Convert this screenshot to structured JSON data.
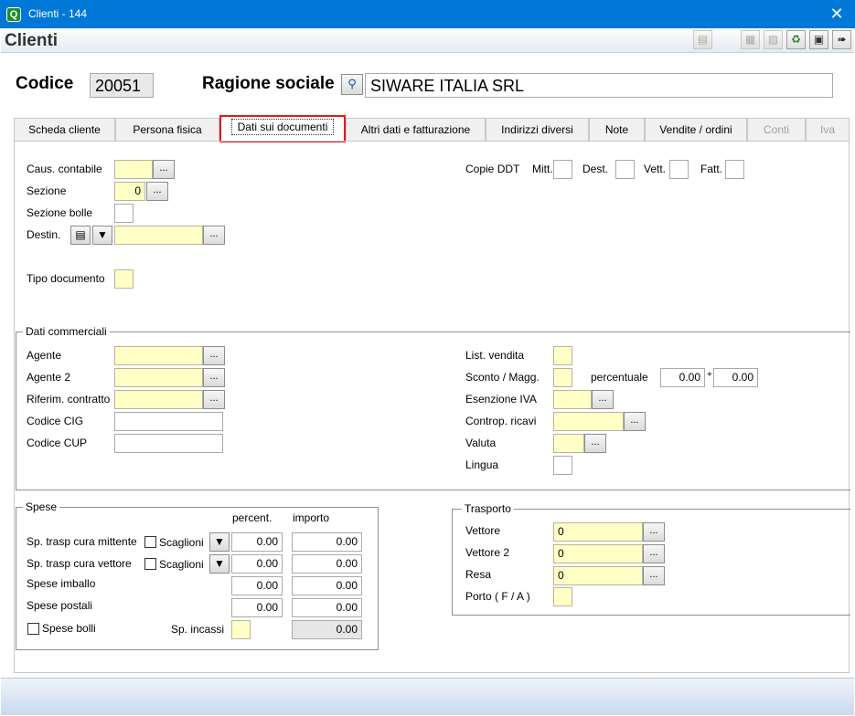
{
  "window": {
    "title": "Clienti - 144",
    "app_icon": "Q",
    "close_glyph": "✕"
  },
  "header": {
    "title": "Clienti"
  },
  "toolbar_icons": [
    "print-icon",
    "copy-icon",
    "paste-icon",
    "recycle-icon",
    "save-icon",
    "exit-icon"
  ],
  "top": {
    "codice_label": "Codice",
    "codice_value": "20051",
    "ragione_label": "Ragione sociale",
    "ragione_value": "SIWARE ITALIA SRL"
  },
  "tabs": [
    {
      "label": "Scheda cliente"
    },
    {
      "label": "Persona fisica"
    },
    {
      "label": "Dati sui documenti"
    },
    {
      "label": "Altri dati e fatturazione"
    },
    {
      "label": "Indirizzi diversi"
    },
    {
      "label": "Note"
    },
    {
      "label": "Vendite / ordini"
    },
    {
      "label": "Conti"
    },
    {
      "label": "Iva"
    }
  ],
  "docs": {
    "caus_label": "Caus. contabile",
    "caus_value": "",
    "sezione_label": "Sezione",
    "sezione_value": "0",
    "sezione_bolle_label": "Sezione bolle",
    "destin_label": "Destin.",
    "tipo_doc_label": "Tipo documento",
    "copie_label": "Copie DDT",
    "mitt_label": "Mitt.",
    "dest_label": "Dest.",
    "vett_label": "Vett.",
    "fatt_label": "Fatt."
  },
  "commerciali": {
    "title": "Dati commerciali",
    "agente_label": "Agente",
    "agente2_label": "Agente 2",
    "riferim_label": "Riferim. contratto",
    "cig_label": "Codice CIG",
    "cup_label": "Codice CUP",
    "listino_label": "List. vendita",
    "sconto_label": "Sconto / Magg.",
    "percentuale_label": "percentuale",
    "perc1": "0.00",
    "plus": "+",
    "perc2": "0.00",
    "esenzione_label": "Esenzione IVA",
    "controp_label": "Controp. ricavi",
    "valuta_label": "Valuta",
    "lingua_label": "Lingua"
  },
  "spese": {
    "title": "Spese",
    "percent_header": "percent.",
    "importo_header": "importo",
    "mittente_label": "Sp. trasp cura mittente",
    "vettore_label": "Sp. trasp cura vettore",
    "scaglioni_label": "Scaglioni",
    "imballo_label": "Spese imballo",
    "postali_label": "Spese postali",
    "bolli_label": "Spese bolli",
    "incassi_label": "Sp. incassi",
    "mittente_perc": "0.00",
    "mittente_imp": "0.00",
    "vettore_perc": "0.00",
    "vettore_imp": "0.00",
    "imballo_perc": "0.00",
    "imballo_imp": "0.00",
    "postali_perc": "0.00",
    "postali_imp": "0.00",
    "incassi_imp": "0.00"
  },
  "trasporto": {
    "title": "Trasporto",
    "vettore_label": "Vettore",
    "vettore_value": "0",
    "vettore2_label": "Vettore 2",
    "vettore2_value": "0",
    "resa_label": "Resa",
    "resa_value": "0",
    "porto_label": "Porto ( F / A )"
  },
  "ellipsis": "..."
}
